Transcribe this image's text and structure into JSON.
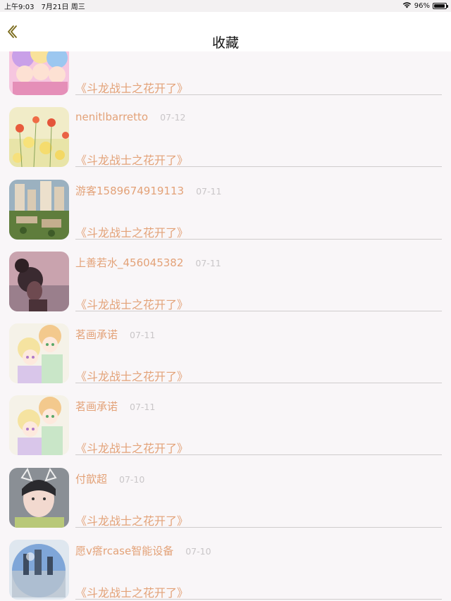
{
  "status_bar": {
    "time": "上午9:03",
    "date": "7月21日 周三",
    "battery": "96%",
    "battery_level": 0.96
  },
  "nav": {
    "title": "收藏",
    "back_icon": "chevron-left-icon"
  },
  "favorites": [
    {
      "user": "",
      "date": "",
      "title": "《斗龙战士之花开了》",
      "avatar": "anime-group"
    },
    {
      "user": "nenitlbarretto",
      "date": "07-12",
      "title": "《斗龙战士之花开了》",
      "avatar": "flowers"
    },
    {
      "user": "游客1589674919113",
      "date": "07-11",
      "title": "《斗龙战士之花开了》",
      "avatar": "buildings"
    },
    {
      "user": "上善若水_456045382",
      "date": "07-11",
      "title": "《斗龙战士之花开了》",
      "avatar": "girl-sunset"
    },
    {
      "user": "茗画承诺",
      "date": "07-11",
      "title": "《斗龙战士之花开了》",
      "avatar": "anime-girls"
    },
    {
      "user": "茗画承诺",
      "date": "07-11",
      "title": "《斗龙战士之花开了》",
      "avatar": "anime-girls"
    },
    {
      "user": "付歆超",
      "date": "07-10",
      "title": "《斗龙战士之花开了》",
      "avatar": "child-cat-ears"
    },
    {
      "user": "愿v瘩rcase智能设备",
      "date": "07-10",
      "title": "《斗龙战士之花开了》",
      "avatar": "glass-sphere"
    }
  ],
  "colors": {
    "accent": "#e3a278",
    "date": "#c9c6c8",
    "background": "#f9f6f8",
    "nav_background": "#ffffff",
    "back_icon": "#7a6a1a"
  }
}
